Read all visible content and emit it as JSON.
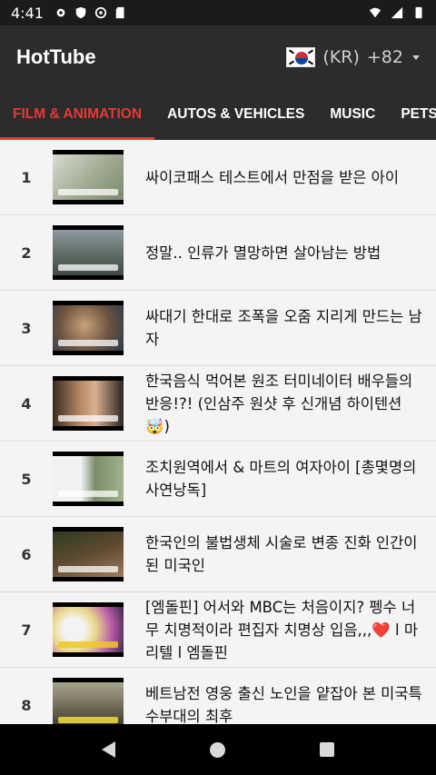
{
  "status": {
    "time": "4:41"
  },
  "app": {
    "title": "HotTube",
    "country_code": "(KR)",
    "dial_code": "+82"
  },
  "tabs": [
    {
      "label": "FILM & ANIMATION",
      "active": true
    },
    {
      "label": "AUTOS & VEHICLES",
      "active": false
    },
    {
      "label": "MUSIC",
      "active": false
    },
    {
      "label": "PETS",
      "active": false
    }
  ],
  "videos": [
    {
      "rank": "1",
      "title": "싸이코패스 테스트에서 만점을 받은 아이"
    },
    {
      "rank": "2",
      "title": "정말.. 인류가 멸망하면 살아남는 방법"
    },
    {
      "rank": "3",
      "title": "싸대기 한대로 조폭을 오줌 지리게 만드는 남자"
    },
    {
      "rank": "4",
      "title": "한국음식 먹어본 원조 터미네이터 배우들의 반응!?! (인삼주 원샷 후 신개념 하이텐션🤯)"
    },
    {
      "rank": "5",
      "title": "조치원역에서 & 마트의 여자아이 [총몇명의 사연낭독]"
    },
    {
      "rank": "6",
      "title": "한국인의 불법생체 시술로 변종 진화 인간이 된 미국인"
    },
    {
      "rank": "7",
      "title": "[엠돌핀] 어서와 MBC는 처음이지? 펭수 너무 치명적이라 편집자 치명상 입음,,,❤️ l 마리텔 l 엠돌핀"
    },
    {
      "rank": "8",
      "title": "베트남전 영웅 출신 노인을 얕잡아 본 미국특수부대의 최후"
    }
  ],
  "colors": {
    "accent": "#e53935",
    "app_bar": "#2c2c2c",
    "status_bar": "#1b1b1b"
  }
}
